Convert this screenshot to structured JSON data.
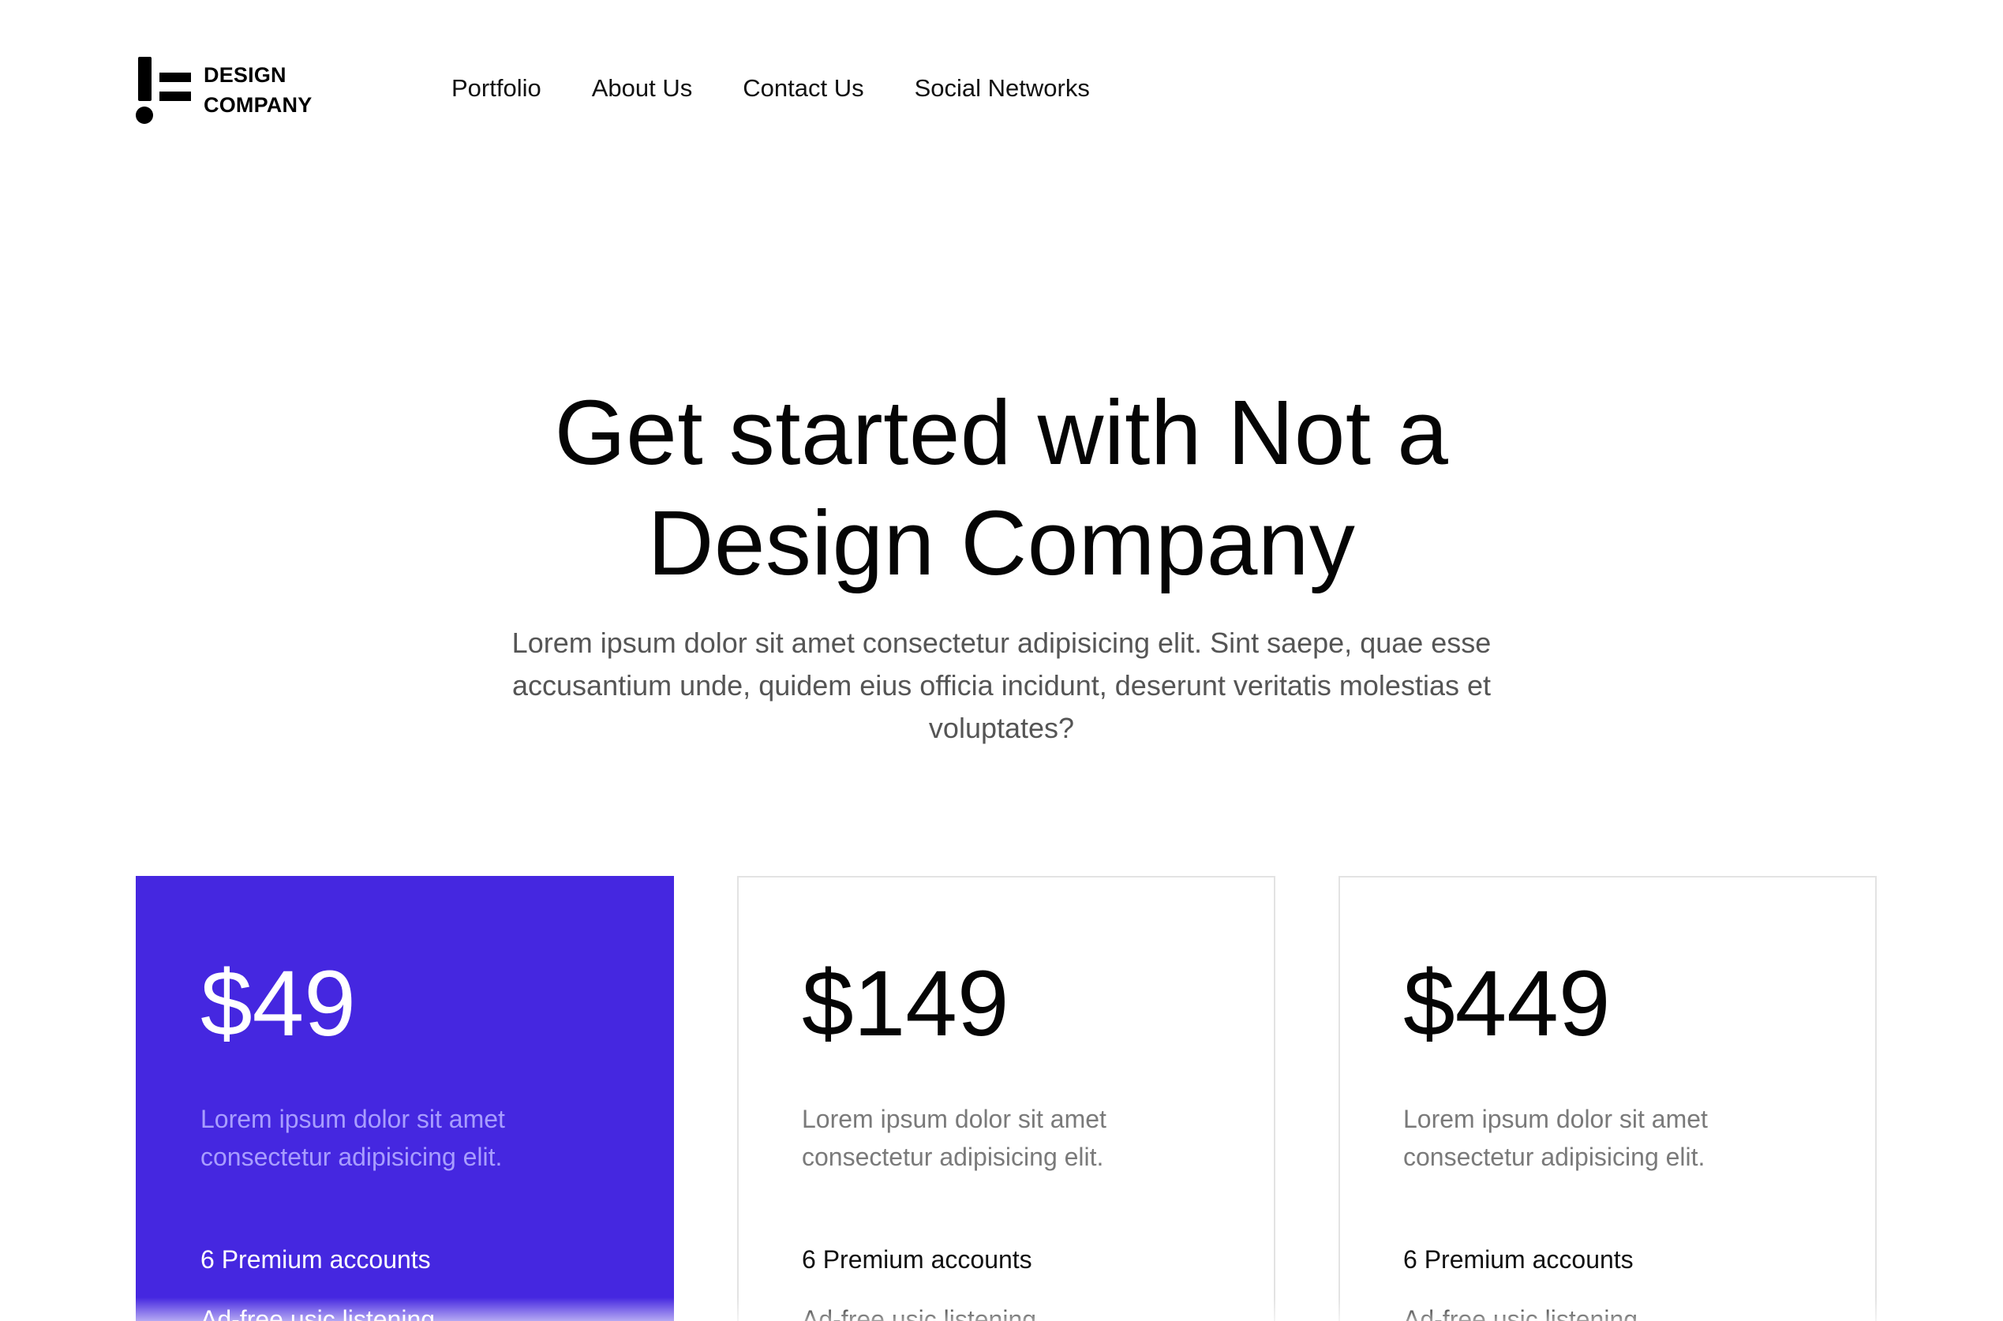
{
  "brand": {
    "line1": "DESIGN",
    "line2": "COMPANY"
  },
  "nav": {
    "items": [
      {
        "label": "Portfolio"
      },
      {
        "label": "About Us"
      },
      {
        "label": "Contact Us"
      },
      {
        "label": "Social Networks"
      }
    ]
  },
  "hero": {
    "title_line1": "Get started with Not a",
    "title_line2": "Design Company",
    "subtitle": "Lorem ipsum dolor sit amet consectetur adipisicing elit. Sint saepe, quae esse accusantium unde, quidem eius officia incidunt, deserunt veritatis molestias et voluptates?"
  },
  "plans": [
    {
      "price": "$49",
      "description": "Lorem ipsum dolor sit amet consectetur adipisicing elit.",
      "features": [
        "6 Premium accounts",
        "Ad-free usic listening"
      ]
    },
    {
      "price": "$149",
      "description": "Lorem ipsum dolor sit amet consectetur adipisicing elit.",
      "features": [
        "6 Premium accounts",
        "Ad-free usic listening"
      ]
    },
    {
      "price": "$449",
      "description": "Lorem ipsum dolor sit amet consectetur adipisicing elit.",
      "features": [
        "6 Premium accounts",
        "Ad-free usic listening"
      ]
    }
  ],
  "colors": {
    "accent": "#4527e0",
    "text": "#050505",
    "muted": "#555555"
  }
}
